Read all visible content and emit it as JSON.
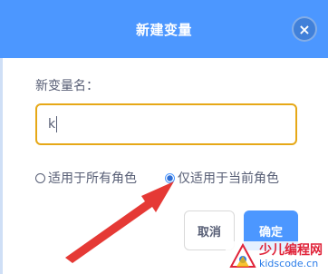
{
  "dialog": {
    "title": "新建变量",
    "close_symbol": "×",
    "field_label": "新变量名：",
    "input_value": "k",
    "scope_options": [
      {
        "label": "适用于所有角色",
        "selected": false
      },
      {
        "label": "仅适用于当前角色",
        "selected": true
      }
    ],
    "cancel_label": "取消",
    "ok_label": "确定"
  },
  "colors": {
    "header_blue": "#4c97ff",
    "input_border_focus": "#e6a817",
    "annotation_arrow": "#e53935"
  },
  "watermark": {
    "name_cn": "少儿编程网",
    "url": "kidscode.cn"
  }
}
